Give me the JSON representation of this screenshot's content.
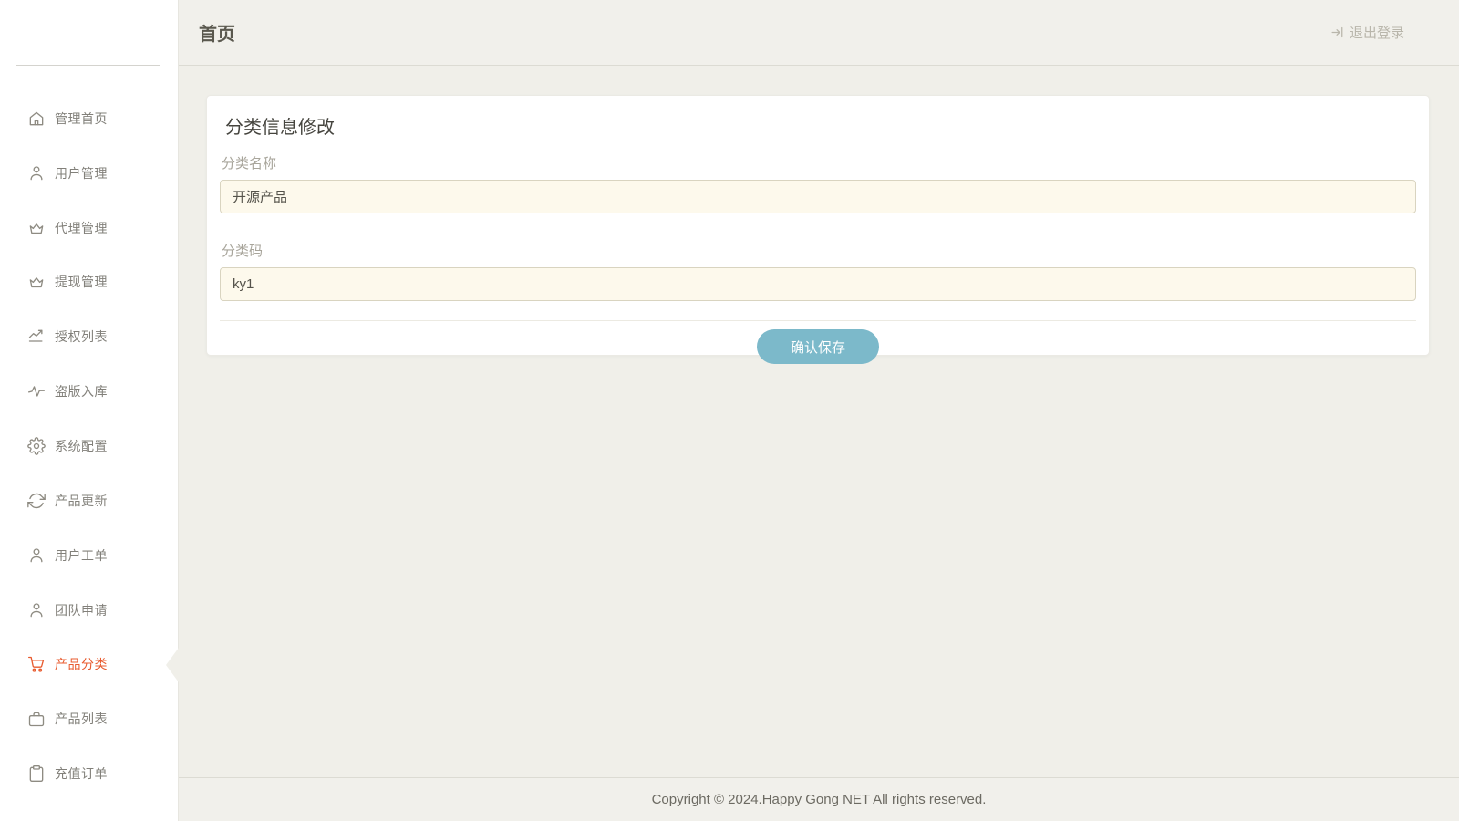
{
  "header": {
    "title": "首页",
    "logout_label": "退出登录"
  },
  "sidebar": {
    "items": [
      {
        "label": "管理首页",
        "icon": "home-icon",
        "active": false
      },
      {
        "label": "用户管理",
        "icon": "user-icon",
        "active": false
      },
      {
        "label": "代理管理",
        "icon": "crown-icon",
        "active": false
      },
      {
        "label": "提现管理",
        "icon": "crown-icon",
        "active": false
      },
      {
        "label": "授权列表",
        "icon": "trending-up-icon",
        "active": false
      },
      {
        "label": "盗版入库",
        "icon": "activity-icon",
        "active": false
      },
      {
        "label": "系统配置",
        "icon": "gear-icon",
        "active": false
      },
      {
        "label": "产品更新",
        "icon": "refresh-icon",
        "active": false
      },
      {
        "label": "用户工单",
        "icon": "user-icon",
        "active": false
      },
      {
        "label": "团队申请",
        "icon": "user-icon",
        "active": false
      },
      {
        "label": "产品分类",
        "icon": "cart-icon",
        "active": true
      },
      {
        "label": "产品列表",
        "icon": "briefcase-icon",
        "active": false
      },
      {
        "label": "充值订单",
        "icon": "clipboard-icon",
        "active": false
      }
    ]
  },
  "form": {
    "title": "分类信息修改",
    "fields": [
      {
        "label": "分类名称",
        "value": "开源产品"
      },
      {
        "label": "分类码",
        "value": "ky1"
      }
    ],
    "submit_label": "确认保存"
  },
  "footer": {
    "copyright": "Copyright © 2024.Happy Gong NET All rights reserved."
  },
  "colors": {
    "active_accent": "#e85b2f",
    "button": "#7cb9ca",
    "input_bg": "#fdf9ec",
    "content_bg": "#f0efe9",
    "sidebar_bg": "#ffffff"
  }
}
